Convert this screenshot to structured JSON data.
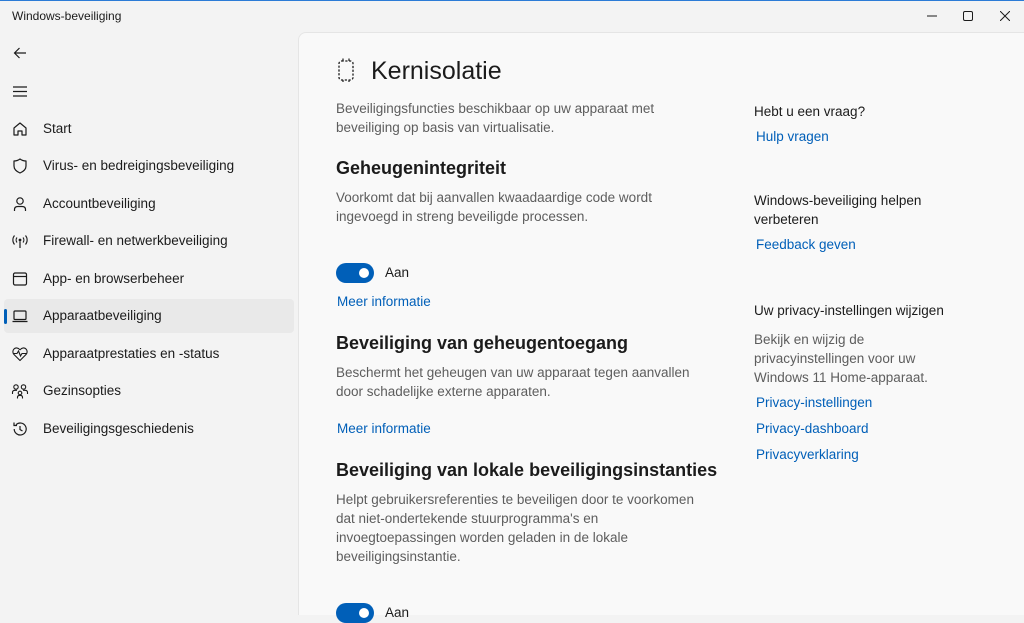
{
  "window": {
    "title": "Windows-beveiliging"
  },
  "sidebar": {
    "items": [
      {
        "label": "Start",
        "icon": "home-icon"
      },
      {
        "label": "Virus- en bedreigingsbeveiliging",
        "icon": "shield-icon"
      },
      {
        "label": "Accountbeveiliging",
        "icon": "person-icon"
      },
      {
        "label": "Firewall- en netwerkbeveiliging",
        "icon": "antenna-icon"
      },
      {
        "label": "App- en browserbeheer",
        "icon": "browser-window-icon"
      },
      {
        "label": "Apparaatbeveiliging",
        "icon": "laptop-icon",
        "active": true
      },
      {
        "label": "Apparaatprestaties en -status",
        "icon": "heart-pulse-icon"
      },
      {
        "label": "Gezinsopties",
        "icon": "family-icon"
      },
      {
        "label": "Beveiligingsgeschiedenis",
        "icon": "history-icon"
      }
    ]
  },
  "main": {
    "title": "Kernisolatie",
    "intro": "Beveiligingsfuncties beschikbaar op uw apparaat met beveiliging op basis van virtualisatie.",
    "sections": [
      {
        "heading": "Geheugenintegriteit",
        "description": "Voorkomt dat bij aanvallen kwaadaardige code wordt ingevoegd in streng beveiligde processen.",
        "toggle_label": "Aan",
        "toggle_on": true,
        "link": "Meer informatie"
      },
      {
        "heading": "Beveiliging van geheugentoegang",
        "description": "Beschermt het geheugen van uw apparaat tegen aanvallen door schadelijke externe apparaten.",
        "link": "Meer informatie"
      },
      {
        "heading": "Beveiliging van lokale beveiligingsinstanties",
        "description": "Helpt gebruikersreferenties te beveiligen door te voorkomen dat niet-ondertekende stuurprogramma's en invoegtoepassingen worden geladen in de lokale beveiligingsinstantie.",
        "toggle_label": "Aan",
        "toggle_on": true
      }
    ]
  },
  "aside": {
    "question": {
      "heading": "Hebt u een vraag?",
      "link": "Hulp vragen"
    },
    "improve": {
      "heading": "Windows-beveiliging helpen verbeteren",
      "link": "Feedback geven"
    },
    "privacy": {
      "heading": "Uw privacy-instellingen wijzigen",
      "text": "Bekijk en wijzig de privacyinstellingen voor uw Windows 11 Home-apparaat.",
      "links": [
        "Privacy-instellingen",
        "Privacy-dashboard",
        "Privacyverklaring"
      ]
    }
  },
  "colors": {
    "accent": "#005fb8",
    "sidebar_bg": "#f3f3f3",
    "content_bg": "#f9f9f9"
  }
}
